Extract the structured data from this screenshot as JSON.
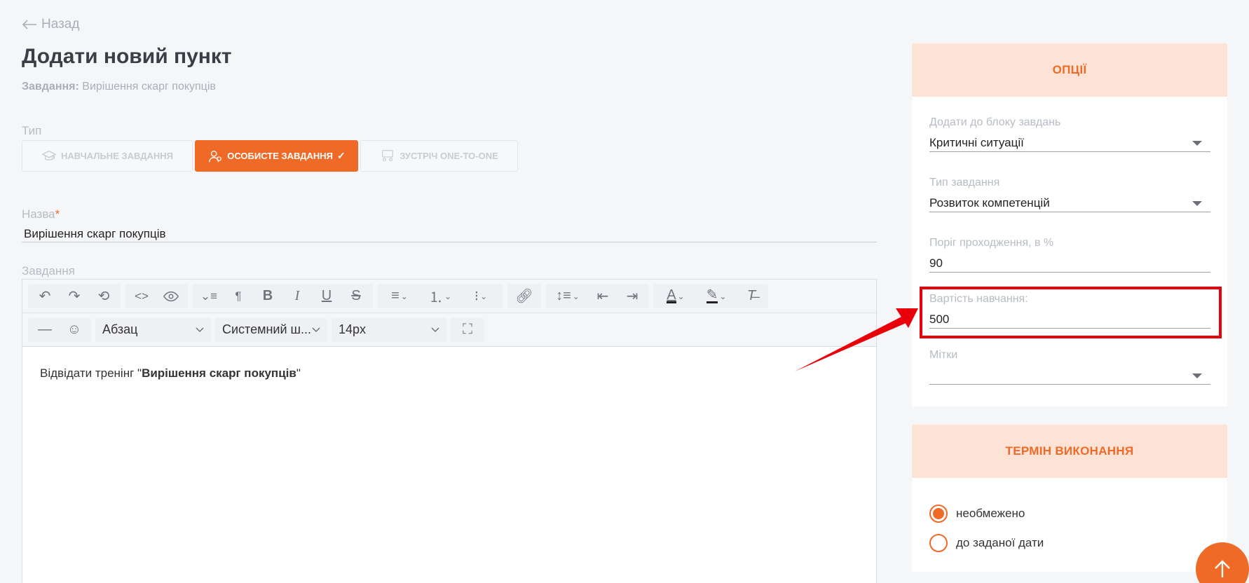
{
  "back_label": "Назад",
  "title": "Додати новий пункт",
  "subtitle": {
    "key": "Завдання:",
    "value": "Вирішення скарг покупців"
  },
  "type_label": "Тип",
  "type_buttons": [
    {
      "label": "Навчальне завдання",
      "icon": "graduation-cap-icon",
      "active": false
    },
    {
      "label": "Особисте завдання",
      "icon": "person-target-icon",
      "active": true
    },
    {
      "label": "Зустріч one-to-one",
      "icon": "meeting-icon",
      "active": false
    }
  ],
  "name_label": "Назва",
  "name_required": "*",
  "name_value": "Вирішення скарг покупців",
  "task_label": "Завдання",
  "editor": {
    "block_format": "Абзац",
    "font_family": "Системний ш...",
    "font_size": "14px",
    "content_prefix": "Відвідати тренінг \"",
    "content_bold": "Вирішення скарг покупців",
    "content_suffix": "\""
  },
  "options": {
    "title": "Опції",
    "block_label": "Додати до блоку завдань",
    "block_value": "Критичні ситуації",
    "task_type_label": "Тип завдання",
    "task_type_value": "Розвиток компетенцій",
    "threshold_label": "Поріг проходження, в %",
    "threshold_value": "90",
    "cost_label": "Вартість навчання:",
    "cost_value": "500",
    "tags_label": "Мітки",
    "tags_value": ""
  },
  "deadline": {
    "title": "Термін виконання",
    "option_unlimited": "необмежено",
    "option_date": "до заданої дати",
    "selected": "unlimited"
  },
  "colors": {
    "accent": "#ee6a26",
    "header_bg": "#fde3d6",
    "highlight": "#e8000b"
  }
}
